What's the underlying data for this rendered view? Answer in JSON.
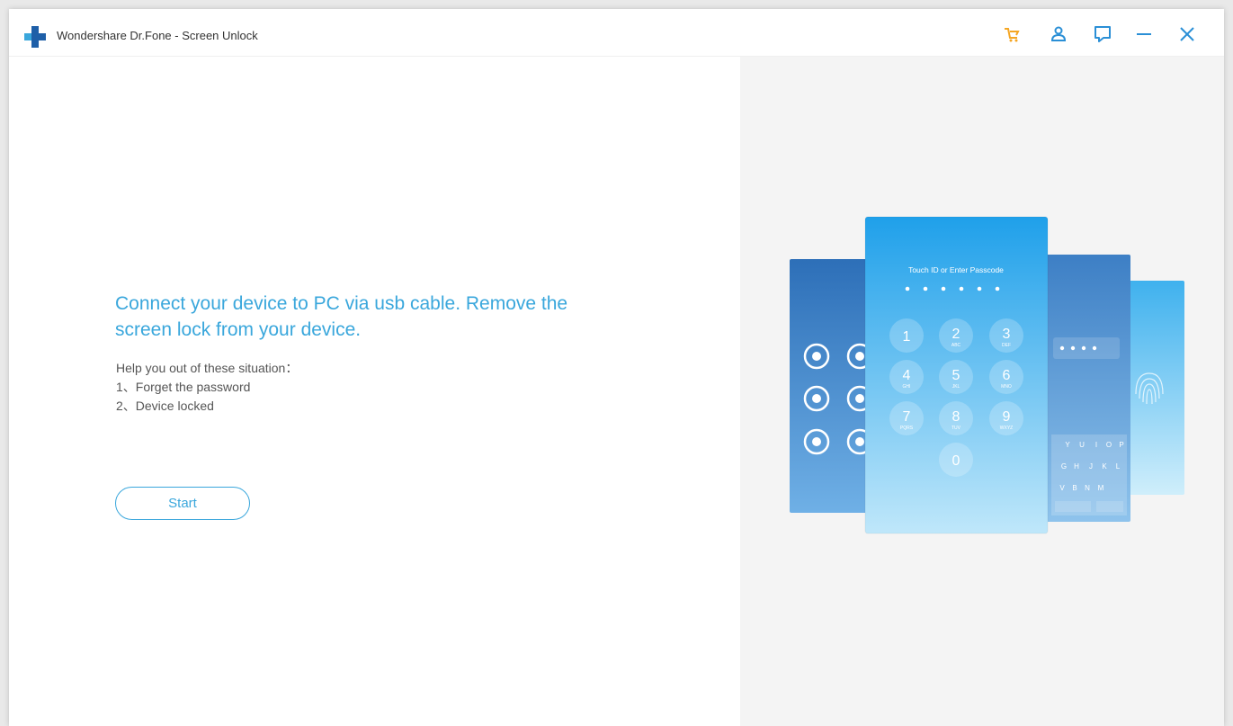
{
  "titlebar": {
    "title": "Wondershare Dr.Fone - Screen Unlock",
    "icons": [
      "cart-icon",
      "user-icon",
      "feedback-icon",
      "minimize-icon",
      "close-icon"
    ],
    "cart_color": "#f5a623",
    "icon_color": "#2a8fd6"
  },
  "main": {
    "headline": "Connect your device to PC via usb cable. Remove the screen lock from your device.",
    "help_title": "Help you out of these situation：",
    "help_items": [
      "1、Forget the password",
      "2、Device locked"
    ],
    "start_label": "Start"
  },
  "illustration": {
    "passcode_prompt": "Touch ID or Enter Passcode",
    "keypad": [
      {
        "digit": "1",
        "letters": ""
      },
      {
        "digit": "2",
        "letters": "ABC"
      },
      {
        "digit": "3",
        "letters": "DEF"
      },
      {
        "digit": "4",
        "letters": "GHI"
      },
      {
        "digit": "5",
        "letters": "JKL"
      },
      {
        "digit": "6",
        "letters": "MNO"
      },
      {
        "digit": "7",
        "letters": "PQRS"
      },
      {
        "digit": "8",
        "letters": "TUV"
      },
      {
        "digit": "9",
        "letters": "WXYZ"
      },
      {
        "digit": "0",
        "letters": ""
      }
    ],
    "keyboard_rows": [
      [
        "Y",
        "U",
        "I",
        "O",
        "P"
      ],
      [
        "G",
        "H",
        "J",
        "K",
        "L"
      ],
      [
        "V",
        "B",
        "N",
        "M"
      ]
    ],
    "colors": {
      "accent": "#3aa7dc",
      "phone_dark": "#2d6fb8",
      "phone_light": "#3eb2ee"
    }
  }
}
